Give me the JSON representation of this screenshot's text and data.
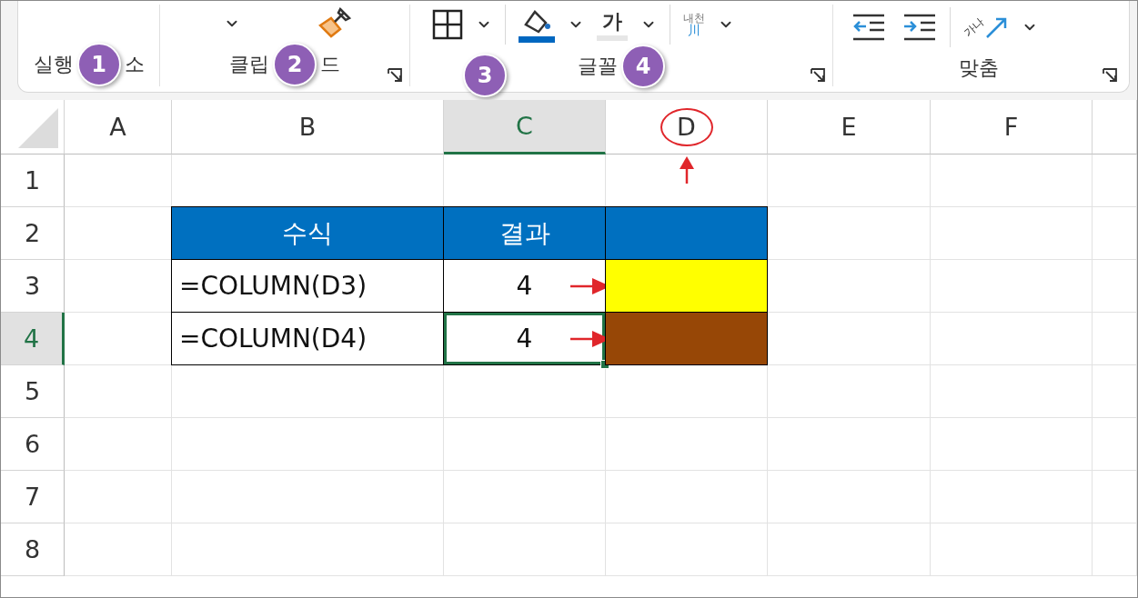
{
  "ribbon": {
    "groups": [
      {
        "label": [
          "실행",
          "소"
        ],
        "badge": "1"
      },
      {
        "label": [
          "클립",
          "드"
        ],
        "badge": "2",
        "launcher": true,
        "tools": [
          {
            "kind": "chevron"
          },
          {
            "kind": "brush"
          }
        ]
      },
      {
        "label": [
          "글꼴"
        ],
        "badge": "4",
        "extra_badge": "3",
        "launcher": true,
        "tools": [
          {
            "kind": "borders"
          },
          {
            "kind": "chevron"
          },
          {
            "kind": "separator"
          },
          {
            "kind": "fill"
          },
          {
            "kind": "chevron"
          },
          {
            "kind": "font-color",
            "label": "가"
          },
          {
            "kind": "chevron"
          },
          {
            "kind": "separator"
          },
          {
            "kind": "phonetic",
            "top": "내천",
            "bottom": "川"
          },
          {
            "kind": "chevron"
          }
        ]
      },
      {
        "label": [
          "맞춤"
        ],
        "launcher": true,
        "tools": [
          {
            "kind": "indent-decrease"
          },
          {
            "kind": "indent-increase"
          },
          {
            "kind": "separator"
          },
          {
            "kind": "orientation",
            "label": "가나"
          },
          {
            "kind": "chevron"
          }
        ]
      }
    ]
  },
  "sheet": {
    "columns": [
      {
        "label": "A",
        "selected": false,
        "annotated": false
      },
      {
        "label": "B",
        "selected": false,
        "annotated": false
      },
      {
        "label": "C",
        "selected": true,
        "annotated": false
      },
      {
        "label": "D",
        "selected": false,
        "annotated": true
      },
      {
        "label": "E",
        "selected": false,
        "annotated": false
      },
      {
        "label": "F",
        "selected": false,
        "annotated": false
      }
    ],
    "rows": [
      {
        "label": "1",
        "selected": false
      },
      {
        "label": "2",
        "selected": false
      },
      {
        "label": "3",
        "selected": false
      },
      {
        "label": "4",
        "selected": true
      },
      {
        "label": "5",
        "selected": false
      },
      {
        "label": "6",
        "selected": false
      },
      {
        "label": "7",
        "selected": false
      },
      {
        "label": "8",
        "selected": false
      }
    ],
    "table": {
      "rows": [
        [
          {
            "text": "수식",
            "color": "#0070c0",
            "selected": false
          },
          {
            "text": "결과",
            "color": "#0070c0",
            "selected": false
          },
          {
            "color": "#0070c0",
            "selected": false
          }
        ],
        [
          {
            "text": "=COLUMN(D3)",
            "selected": false
          },
          {
            "text": "4",
            "selected": false,
            "arrow": true
          },
          {
            "color": "#ffff00",
            "selected": false
          }
        ],
        [
          {
            "text": "=COLUMN(D4)",
            "selected": false
          },
          {
            "text": "4",
            "selected": true,
            "arrow": true
          },
          {
            "color": "#974706",
            "selected": false
          }
        ]
      ]
    }
  }
}
